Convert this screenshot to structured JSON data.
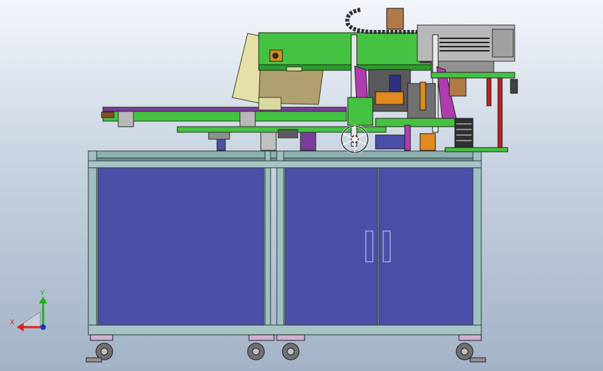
{
  "view": {
    "background_top": "#f3f6fb",
    "background_bottom": "#a3b2c6"
  },
  "triad": {
    "x_label": "X",
    "y_label": "Y",
    "x_color": "#e02020",
    "y_color": "#20b020",
    "z_color": "#2030d0"
  },
  "colors": {
    "frame": "#8fb0b0",
    "cabinet_panel": "#4b4fa8",
    "hopper": "#e4e0a8",
    "main_plate": "#45c241",
    "magenta_parts": "#b03cb0",
    "orange_parts": "#e08a20",
    "control_box": "#b8b8b8",
    "red_post": "#c02020"
  }
}
